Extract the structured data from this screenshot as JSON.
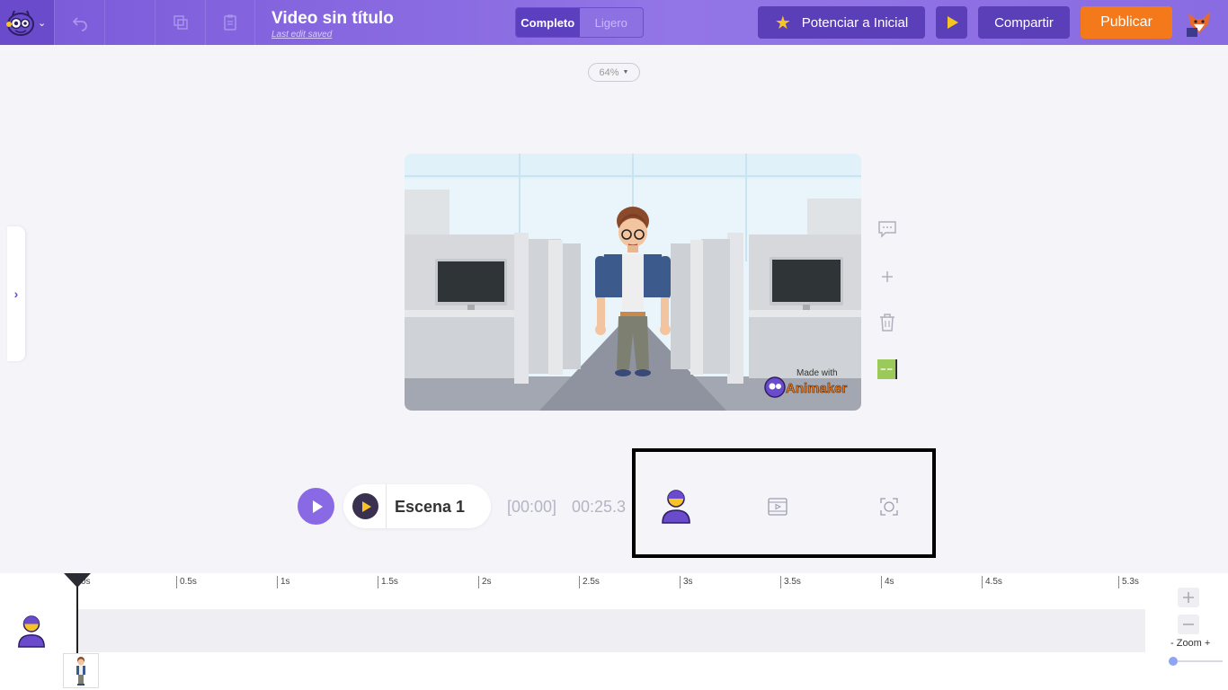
{
  "header": {
    "title": "Video sin título",
    "subtitle": "Last edit saved",
    "modes": [
      "Completo",
      "Ligero"
    ],
    "active_mode": "Completo",
    "upgrade_label": "Potenciar a Inicial",
    "share_label": "Compartir",
    "publish_label": "Publicar",
    "colors": {
      "bar": "#8a6ce2",
      "publish": "#f3791b",
      "button": "#5a3fb9"
    }
  },
  "canvas": {
    "zoom": "64%",
    "watermark_top": "Made with",
    "watermark_brand": "Animaker"
  },
  "player": {
    "scene_name": "Escena 1",
    "current_time": "[00:00]",
    "total_time": "00:25.3"
  },
  "highlight": {
    "icons": [
      "character-icon",
      "video-clip-icon",
      "camera-focus-icon"
    ]
  },
  "timeline": {
    "ticks": [
      "0s",
      "0.5s",
      "1s",
      "1.5s",
      "2s",
      "2.5s",
      "3s",
      "3.5s",
      "4s",
      "4.5s",
      "5.3s"
    ],
    "zoom_label": "- Zoom +",
    "zoom_level": 0.0
  }
}
